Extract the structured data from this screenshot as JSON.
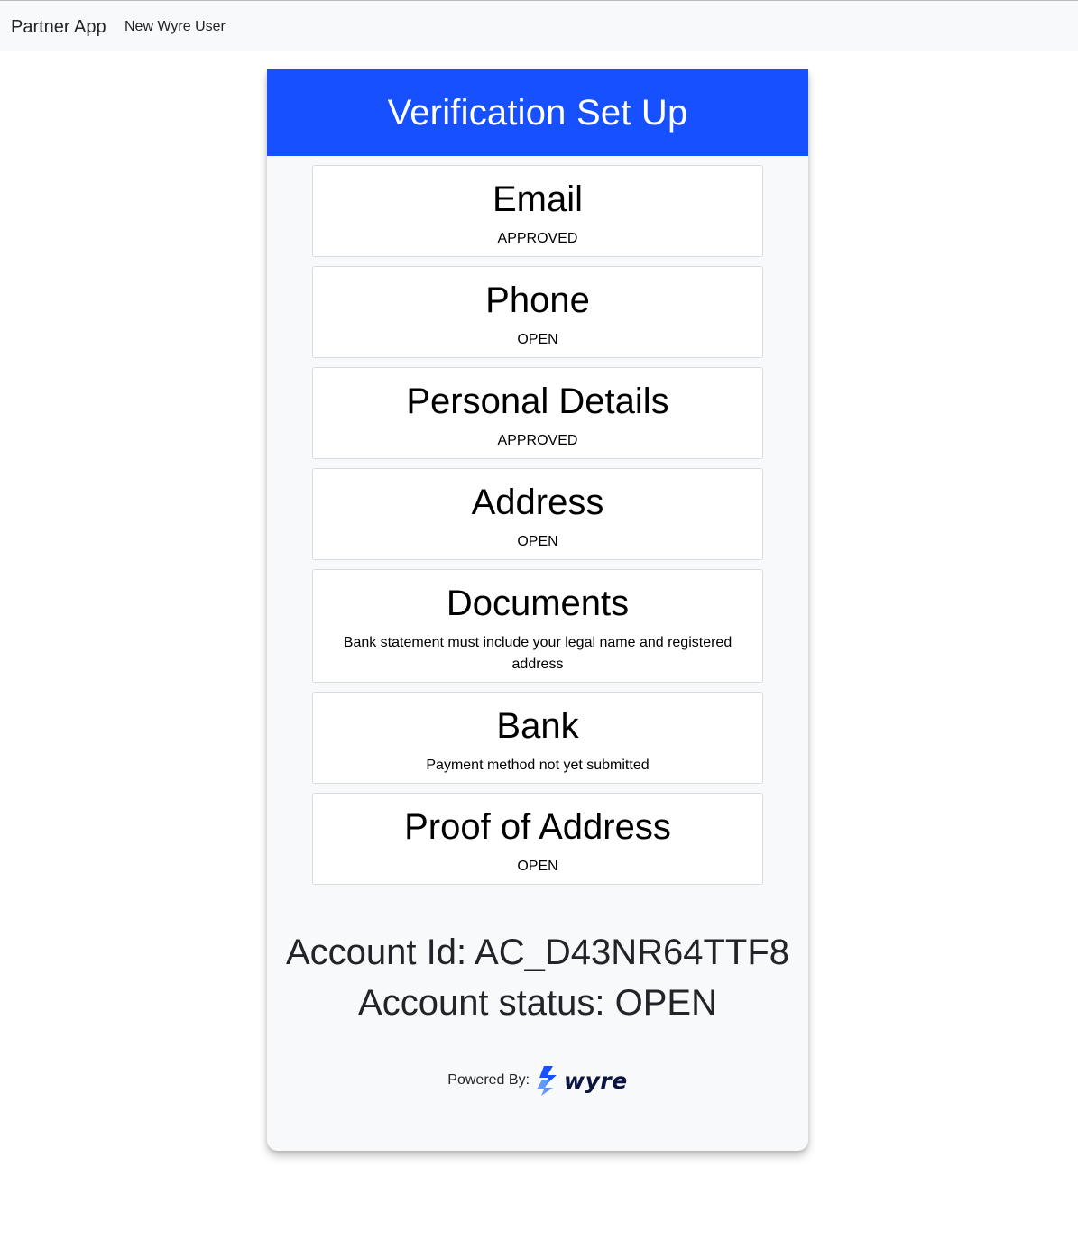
{
  "navbar": {
    "brand": "Partner App",
    "link": "New Wyre User"
  },
  "card": {
    "title": "Verification Set Up",
    "steps": [
      {
        "title": "Email",
        "status": "APPROVED"
      },
      {
        "title": "Phone",
        "status": "OPEN"
      },
      {
        "title": "Personal Details",
        "status": "APPROVED"
      },
      {
        "title": "Address",
        "status": "OPEN"
      },
      {
        "title": "Documents",
        "status": "Bank statement must include your legal name and registered address"
      },
      {
        "title": "Bank",
        "status": "Payment method not yet submitted"
      },
      {
        "title": "Proof of Address",
        "status": "OPEN"
      }
    ],
    "account_id": "Account Id: AC_D43NR64TTF8",
    "account_status": "Account status: OPEN",
    "powered_by": "Powered By:",
    "logo_text": "wyre"
  },
  "colors": {
    "header_blue": "#1650ff",
    "card_bg": "#f8f9fa",
    "navbar_bg": "#f8f9fa",
    "logo_dark": "#0b1440"
  },
  "icons": {
    "logo": "wyre-bolt-icon"
  }
}
